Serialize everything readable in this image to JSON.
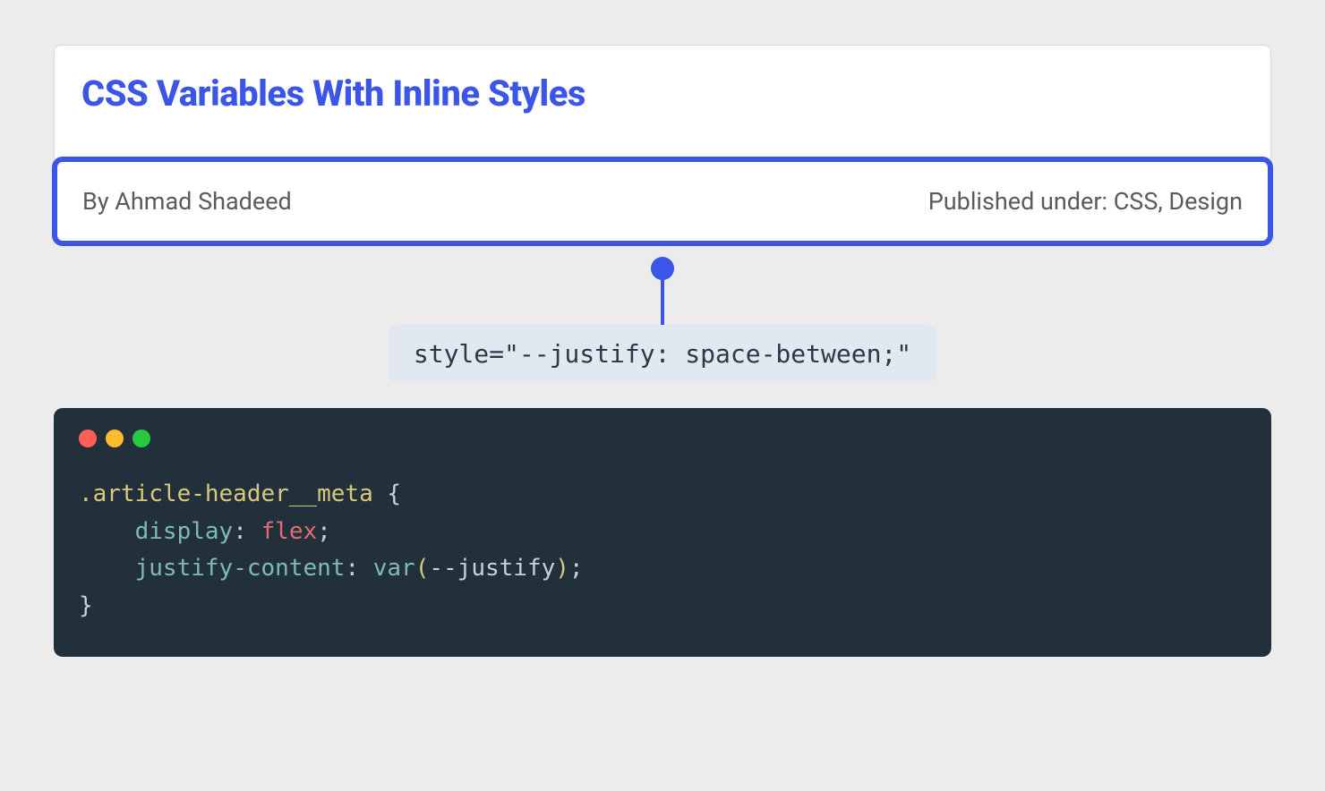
{
  "article": {
    "title": "CSS Variables With Inline Styles",
    "author": "By Ahmad Shadeed",
    "published": "Published under: CSS, Design"
  },
  "annotation": {
    "inline_style": "style=\"--justify: space-between;\""
  },
  "code": {
    "selector": ".article-header__meta",
    "open_brace": " {",
    "prop1": "display",
    "colon": ":",
    "val1": "flex",
    "semi": ";",
    "prop2": "justify-content",
    "func": "var",
    "lparen": "(",
    "varname": "--justify",
    "rparen": ")",
    "close_brace": "}"
  }
}
